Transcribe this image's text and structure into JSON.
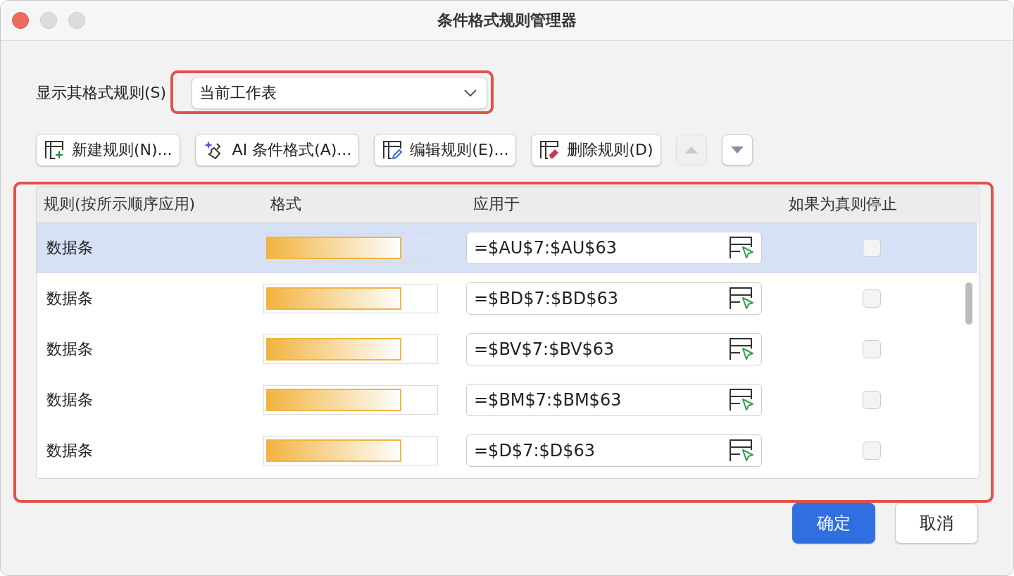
{
  "window": {
    "title": "条件格式规则管理器"
  },
  "scope": {
    "label": "显示其格式规则(S)",
    "value": "当前工作表",
    "highlighted": true
  },
  "toolbar": [
    {
      "kind": "new",
      "label": "新建规则(N)..."
    },
    {
      "kind": "ai",
      "label": "AI 条件格式(A)..."
    },
    {
      "kind": "edit",
      "label": "编辑规则(E)..."
    },
    {
      "kind": "delete",
      "label": "删除规则(D)"
    }
  ],
  "move_buttons": [
    {
      "kind": "up",
      "disabled": true
    },
    {
      "kind": "down",
      "disabled": false
    }
  ],
  "table": {
    "highlighted": true,
    "columns": [
      "规则(按所示顺序应用)",
      "格式",
      "应用于",
      "如果为真则停止"
    ],
    "rows": [
      {
        "rule": "数据条",
        "applies_to": "=$AU$7:$AU$63",
        "stop_if_true": false,
        "selected": true
      },
      {
        "rule": "数据条",
        "applies_to": "=$BD$7:$BD$63",
        "stop_if_true": false,
        "selected": false
      },
      {
        "rule": "数据条",
        "applies_to": "=$BV$7:$BV$63",
        "stop_if_true": false,
        "selected": false
      },
      {
        "rule": "数据条",
        "applies_to": "=$BM$7:$BM$63",
        "stop_if_true": false,
        "selected": false
      },
      {
        "rule": "数据条",
        "applies_to": "=$D$7:$D$63",
        "stop_if_true": false,
        "selected": false
      }
    ]
  },
  "buttons": [
    {
      "kind": "primary",
      "label": "确定"
    },
    {
      "kind": "secondary",
      "label": "取消"
    }
  ]
}
